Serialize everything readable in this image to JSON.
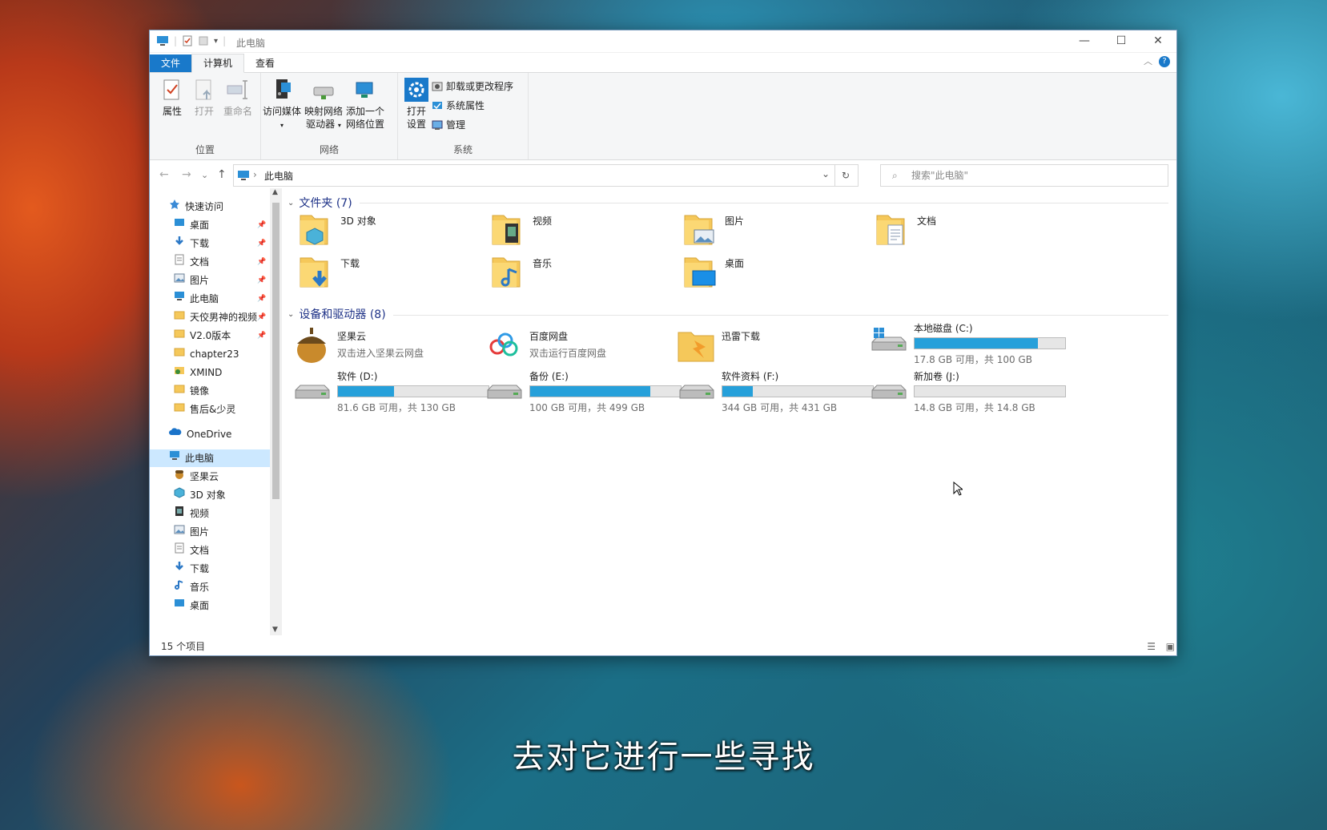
{
  "window": {
    "title": "此电脑",
    "minimize": "—",
    "maximize": "☐",
    "close": "✕"
  },
  "tabs": {
    "file": "文件",
    "computer": "计算机",
    "view": "查看",
    "help": "?"
  },
  "ribbon": {
    "location": {
      "group": "位置",
      "properties": "属性",
      "open": "打开",
      "rename": "重命名"
    },
    "network": {
      "group": "网络",
      "media_line1": "访问媒体",
      "map_line1": "映射网络",
      "map_line2": "驱动器",
      "add_line1": "添加一个",
      "add_line2": "网络位置"
    },
    "system": {
      "group": "系统",
      "open_line1": "打开",
      "open_line2": "设置",
      "uninstall": "卸载或更改程序",
      "sysprops": "系统属性",
      "manage": "管理"
    }
  },
  "address": {
    "path": "此电脑",
    "search_placeholder": "搜索\"此电脑\""
  },
  "sidebar": {
    "quick_access": "快速访问",
    "items": [
      "桌面",
      "下载",
      "文档",
      "图片",
      "此电脑",
      "天佼男神的视频",
      "V2.0版本",
      "chapter23",
      "XMIND",
      "镜像",
      "售后&少灵"
    ],
    "onedrive": "OneDrive",
    "this_pc": "此电脑",
    "pc_items": [
      "坚果云",
      "3D 对象",
      "视频",
      "图片",
      "文档",
      "下载",
      "音乐",
      "桌面"
    ]
  },
  "folders": {
    "header": "文件夹 (7)",
    "items": [
      "3D 对象",
      "视频",
      "图片",
      "文档",
      "下载",
      "音乐",
      "桌面"
    ]
  },
  "devices": {
    "header": "设备和驱动器 (8)",
    "apps": [
      {
        "name": "坚果云",
        "sub": "双击进入坚果云网盘"
      },
      {
        "name": "百度网盘",
        "sub": "双击运行百度网盘"
      },
      {
        "name": "迅雷下载",
        "sub": ""
      }
    ],
    "drives": [
      {
        "name": "本地磁盘 (C:)",
        "info": "17.8 GB 可用，共 100 GB",
        "used": 0.82
      },
      {
        "name": "软件 (D:)",
        "info": "81.6 GB 可用，共 130 GB",
        "used": 0.37
      },
      {
        "name": "备份 (E:)",
        "info": "100 GB 可用，共 499 GB",
        "used": 0.8
      },
      {
        "name": "软件资料 (F:)",
        "info": "344 GB 可用，共 431 GB",
        "used": 0.2
      },
      {
        "name": "新加卷 (J:)",
        "info": "14.8 GB 可用，共 14.8 GB",
        "used": 0.0
      }
    ]
  },
  "status": {
    "count": "15 个项目"
  },
  "subtitle": "去对它进行一些寻找",
  "colors": {
    "accent": "#1979ca",
    "bar": "#26a0da",
    "folder": "#f5c85a"
  }
}
